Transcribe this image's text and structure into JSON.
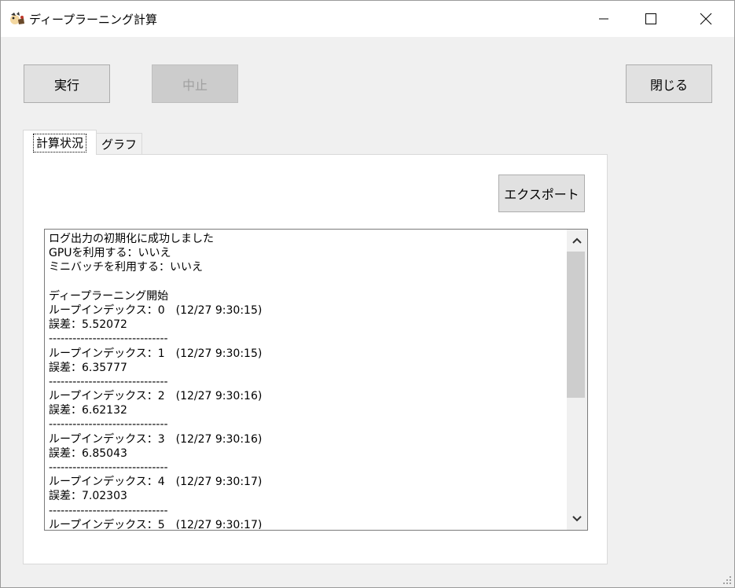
{
  "window": {
    "title": "ディープラーニング計算",
    "icon": "app-icon",
    "controls": [
      "minimize-icon",
      "maximize-icon",
      "close-icon"
    ]
  },
  "toolbar": {
    "run_label": "実行",
    "stop_label": "中止",
    "close_label": "閉じる"
  },
  "tabs": [
    {
      "label": "計算状況",
      "active": true
    },
    {
      "label": "グラフ",
      "active": false
    }
  ],
  "panel": {
    "export_label": "エクスポート"
  },
  "log": {
    "lines": [
      "ログ出力の初期化に成功しました",
      "GPUを利用する：いいえ",
      "ミニバッチを利用する：いいえ",
      "",
      "ディープラーニング開始",
      "ループインデックス：0　(12/27 9:30:15)",
      "誤差：5.52072",
      "------------------------------",
      "ループインデックス：1　(12/27 9:30:15)",
      "誤差：6.35777",
      "------------------------------",
      "ループインデックス：2　(12/27 9:30:16)",
      "誤差：6.62132",
      "------------------------------",
      "ループインデックス：3　(12/27 9:30:16)",
      "誤差：6.85043",
      "------------------------------",
      "ループインデックス：4　(12/27 9:30:17)",
      "誤差：7.02303",
      "------------------------------",
      "ループインデックス：5　(12/27 9:30:17)"
    ]
  }
}
